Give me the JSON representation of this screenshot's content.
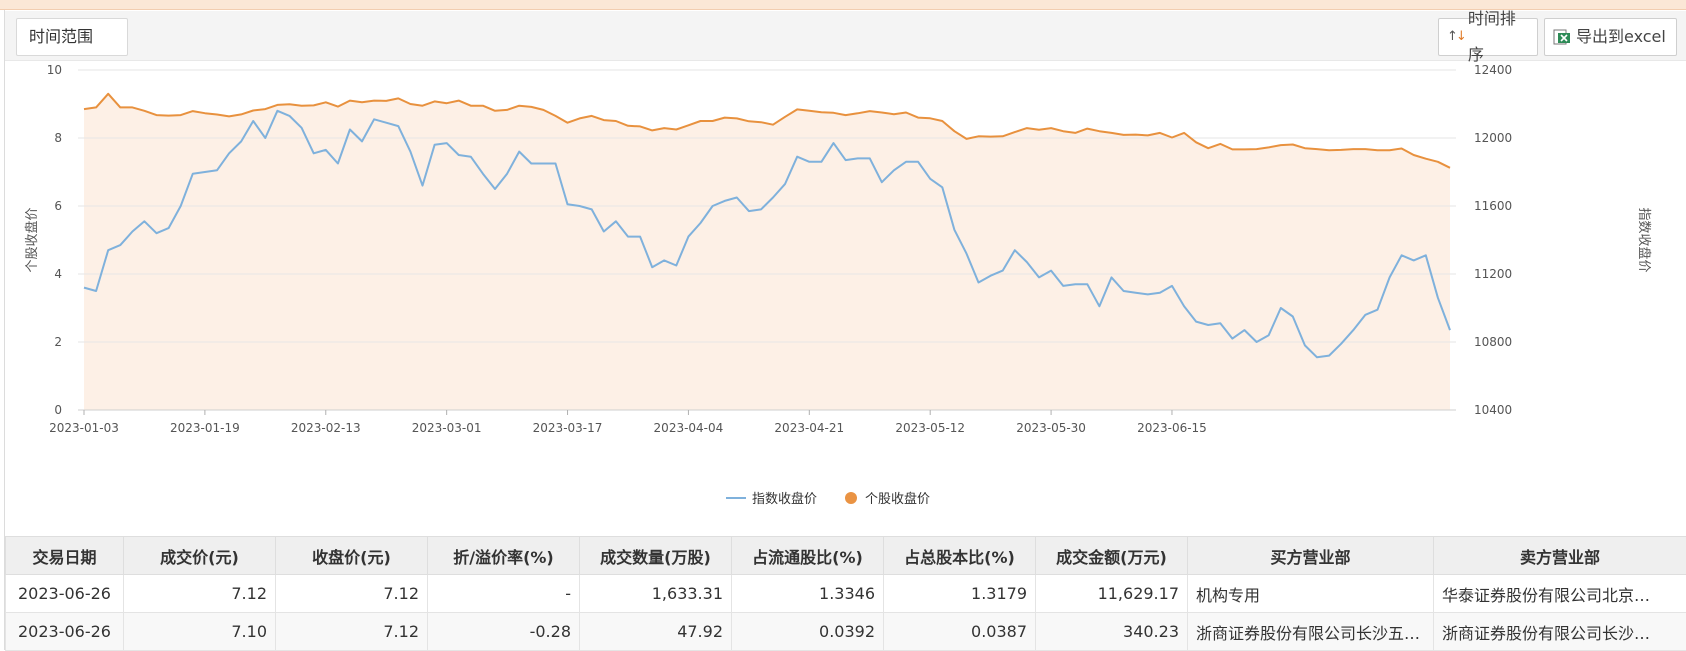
{
  "toolbar": {
    "time_range_label": "时间范围",
    "sort_label": "时间排序",
    "export_label": "导出到excel"
  },
  "colors": {
    "index_line": "#7fb1dc",
    "stock_line": "#e8913e",
    "stock_area": "#fdf0e6",
    "grid": "#e6e6e6"
  },
  "chart_data": {
    "type": "line",
    "left_axis_label": "个股收盘价",
    "right_axis_label": "指数收盘价",
    "left_ylim": [
      0,
      10
    ],
    "left_ticks": [
      "0",
      "2",
      "4",
      "6",
      "8",
      "10"
    ],
    "right_ylim": [
      10400,
      12400
    ],
    "right_ticks": [
      "10400",
      "10800",
      "11200",
      "11600",
      "12000",
      "12400"
    ],
    "x_tick_labels": [
      "2023-01-03",
      "2023-01-19",
      "2023-02-13",
      "2023-03-01",
      "2023-03-17",
      "2023-04-04",
      "2023-04-21",
      "2023-05-12",
      "2023-05-30",
      "2023-06-15"
    ],
    "legend_position": "bottom-center",
    "grid": true,
    "series": [
      {
        "name": "指数收盘价",
        "axis": "left",
        "values": [
          3.6,
          3.5,
          4.7,
          4.85,
          5.25,
          5.55,
          5.2,
          5.35,
          6.0,
          6.95,
          7.0,
          7.05,
          7.55,
          7.9,
          8.5,
          8.0,
          8.8,
          8.65,
          8.3,
          7.55,
          7.65,
          7.25,
          8.25,
          7.9,
          8.55,
          8.45,
          8.35,
          7.6,
          6.6,
          7.8,
          7.85,
          7.5,
          7.45,
          6.95,
          6.5,
          6.95,
          7.6,
          7.25,
          7.25,
          7.25,
          6.05,
          6.0,
          5.9,
          5.25,
          5.55,
          5.1,
          5.1,
          4.2,
          4.4,
          4.25,
          5.1,
          5.5,
          6.0,
          6.15,
          6.25,
          5.85,
          5.9,
          6.25,
          6.65,
          7.45,
          7.3,
          7.3,
          7.85,
          7.35,
          7.4,
          7.4,
          6.7,
          7.05,
          7.3,
          7.3,
          6.8,
          6.55,
          5.3,
          4.6,
          3.75,
          3.95,
          4.1,
          4.7,
          4.35,
          3.9,
          4.1,
          3.65,
          3.7,
          3.7,
          3.05,
          3.9,
          3.5,
          3.45,
          3.4,
          3.45,
          3.65,
          3.05,
          2.6,
          2.5,
          2.55,
          2.1,
          2.35,
          2.0,
          2.2,
          3.0,
          2.75,
          1.9,
          1.55,
          1.6,
          1.95,
          2.35,
          2.8,
          2.95,
          3.9,
          4.55,
          4.4,
          4.55,
          3.3,
          2.35
        ]
      },
      {
        "name": "个股收盘价",
        "axis": "right",
        "values": [
          12170,
          12180,
          12260,
          12180,
          12180,
          12160,
          12135,
          12132,
          12135,
          12158,
          12146,
          12138,
          12127,
          12139,
          12162,
          12170,
          12195,
          12198,
          12190,
          12192,
          12210,
          12185,
          12220,
          12210,
          12220,
          12218,
          12233,
          12200,
          12190,
          12215,
          12205,
          12220,
          12190,
          12190,
          12160,
          12165,
          12190,
          12183,
          12165,
          12130,
          12090,
          12115,
          12130,
          12105,
          12100,
          12072,
          12068,
          12045,
          12058,
          12050,
          12075,
          12100,
          12100,
          12120,
          12115,
          12098,
          12093,
          12078,
          12125,
          12168,
          12160,
          12152,
          12148,
          12135,
          12145,
          12158,
          12150,
          12140,
          12150,
          12120,
          12116,
          12100,
          12040,
          11995,
          12010,
          12008,
          12010,
          12035,
          12058,
          12048,
          12058,
          12040,
          12030,
          12055,
          12040,
          12030,
          12018,
          12020,
          12015,
          12030,
          12003,
          12030,
          11975,
          11940,
          11965,
          11933,
          11933,
          11935,
          11945,
          11958,
          11962,
          11940,
          11935,
          11928,
          11930,
          11935,
          11935,
          11928,
          11928,
          11938,
          11900,
          11878,
          11860,
          11825
        ]
      }
    ]
  },
  "legend": {
    "index_label": "指数收盘价",
    "stock_label": "个股收盘价"
  },
  "table": {
    "headers": [
      "交易日期",
      "成交价(元)",
      "收盘价(元)",
      "折/溢价率(%)",
      "成交数量(万股)",
      "占流通股比(%)",
      "占总股本比(%)",
      "成交金额(万元)",
      "买方营业部",
      "卖方营业部"
    ],
    "rows": [
      [
        "2023-06-26",
        "7.12",
        "7.12",
        "-",
        "1,633.31",
        "1.3346",
        "1.3179",
        "11,629.17",
        "机构专用",
        "华泰证券股份有限公司北京…"
      ],
      [
        "2023-06-26",
        "7.10",
        "7.12",
        "-0.28",
        "47.92",
        "0.0392",
        "0.0387",
        "340.23",
        "浙商证券股份有限公司长沙五…",
        "浙商证券股份有限公司长沙…"
      ]
    ]
  }
}
